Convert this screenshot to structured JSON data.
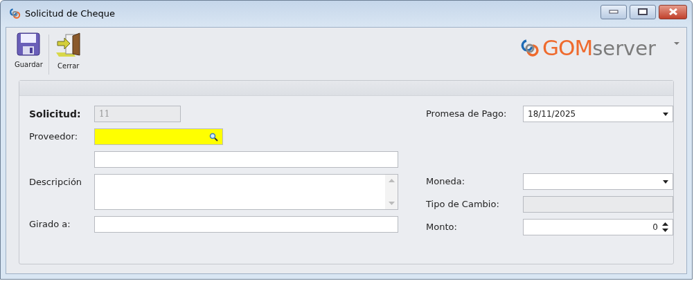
{
  "window": {
    "title": "Solicitud de Cheque"
  },
  "toolbar": [
    {
      "kind": "save",
      "label": "Guardar"
    },
    {
      "kind": "close",
      "label": "Cerrar"
    }
  ],
  "logo": {
    "brand": "GOM",
    "suffix": "server"
  },
  "left_fields": [
    {
      "kind": "text",
      "label": "Solicitud:",
      "label_bold": true,
      "value": "11",
      "disabled": true,
      "highlighted": false
    },
    {
      "kind": "lookup",
      "label": "Proveedor:",
      "label_bold": false,
      "disabled": false,
      "highlighted": true
    },
    {
      "kind": "text",
      "disabled": false,
      "highlighted": false
    },
    {
      "kind": "memo",
      "label": "Descripción",
      "label_bold": false,
      "disabled": false,
      "highlighted": false
    },
    {
      "kind": "text",
      "label": "Girado a:",
      "label_bold": false,
      "disabled": false,
      "highlighted": false
    }
  ],
  "right_fields": [
    {
      "kind": "dropdown",
      "label": "Promesa de Pago:",
      "value": "18/11/2025",
      "disabled": false
    },
    {
      "kind": "dropdown",
      "label": "Moneda:",
      "disabled": false
    },
    {
      "kind": "text",
      "label": "Tipo de Cambio:",
      "disabled": true
    },
    {
      "kind": "spin",
      "label": "Monto:",
      "value": "0",
      "disabled": false
    }
  ]
}
